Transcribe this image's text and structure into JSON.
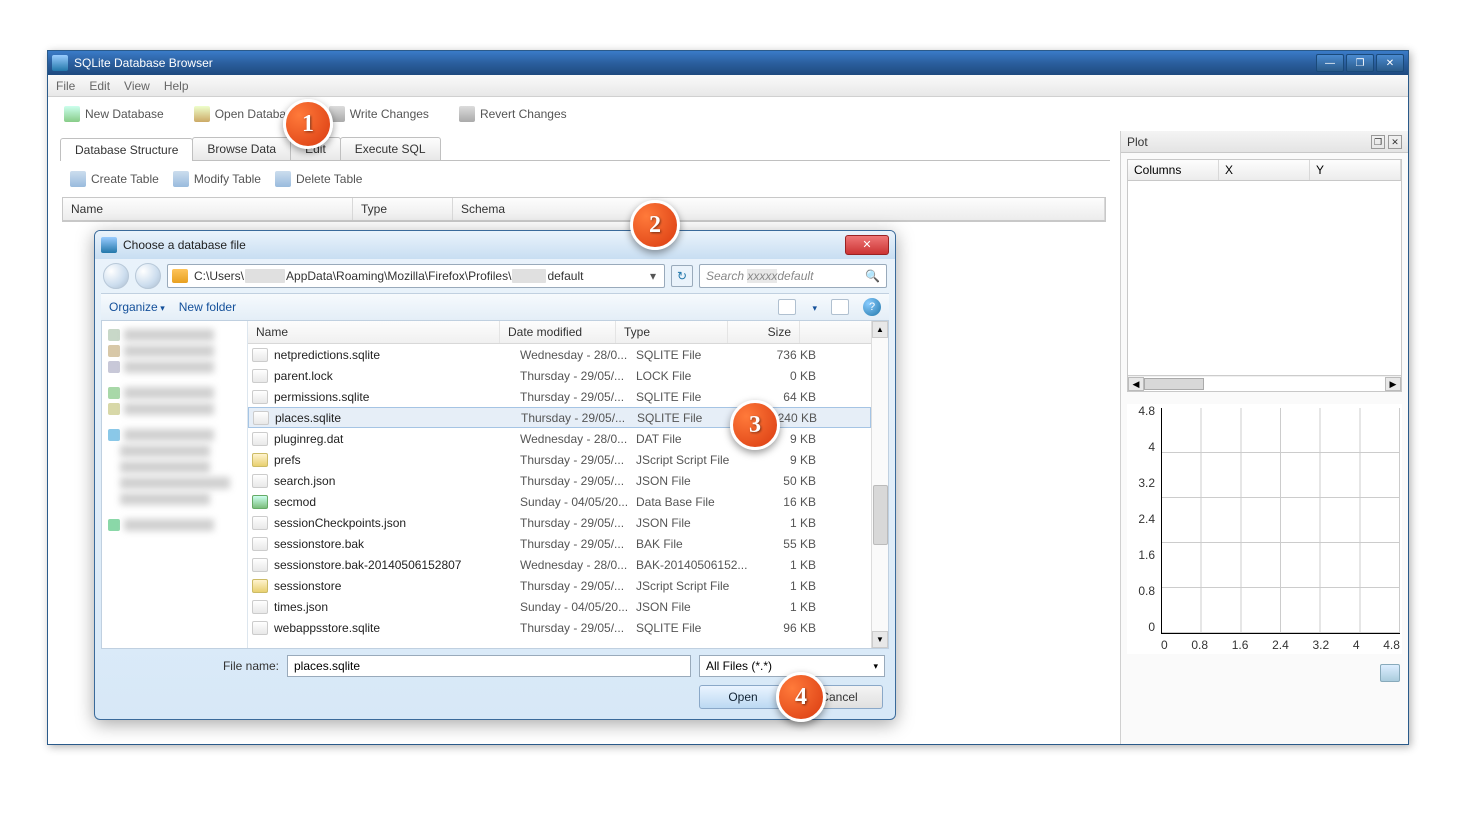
{
  "window": {
    "title": "SQLite Database Browser"
  },
  "menu": {
    "file": "File",
    "edit": "Edit",
    "view": "View",
    "help": "Help"
  },
  "toolbar": {
    "new_db": "New Database",
    "open_db": "Open Database",
    "write_changes": "Write Changes",
    "revert_changes": "Revert Changes"
  },
  "tabs": {
    "structure": "Database Structure",
    "browse": "Browse Data",
    "edit": "Edit",
    "execute": "Execute SQL"
  },
  "subtoolbar": {
    "create": "Create Table",
    "modify": "Modify Table",
    "delete": "Delete Table"
  },
  "structure_cols": {
    "name": "Name",
    "type": "Type",
    "schema": "Schema"
  },
  "plot": {
    "title": "Plot",
    "col_columns": "Columns",
    "col_x": "X",
    "col_y": "Y",
    "scroll_marker": "|||"
  },
  "chart_data": {
    "type": "scatter",
    "x": [],
    "y": [],
    "xlim": [
      0,
      4.8
    ],
    "ylim": [
      0,
      4.8
    ],
    "xticks": [
      "0",
      "0.8",
      "1.6",
      "2.4",
      "3.2",
      "4",
      "4.8"
    ],
    "yticks": [
      "4.8",
      "4",
      "3.2",
      "2.4",
      "1.6",
      "0.8",
      "0"
    ]
  },
  "dialog": {
    "title": "Choose a database file",
    "path_prefix": "C:\\Users\\",
    "path_mid": "AppData\\Roaming\\Mozilla\\Firefox\\Profiles\\",
    "path_suffix": "default",
    "search_placeholder": "Search",
    "search_suffix": "default",
    "organize": "Organize",
    "new_folder": "New folder",
    "cols": {
      "name": "Name",
      "date": "Date modified",
      "type": "Type",
      "size": "Size"
    },
    "files": [
      {
        "name": "netpredictions.sqlite",
        "date": "Wednesday - 28/0...",
        "type": "SQLITE File",
        "size": "736 KB",
        "icon": "file"
      },
      {
        "name": "parent.lock",
        "date": "Thursday - 29/05/...",
        "type": "LOCK File",
        "size": "0 KB",
        "icon": "file"
      },
      {
        "name": "permissions.sqlite",
        "date": "Thursday - 29/05/...",
        "type": "SQLITE File",
        "size": "64 KB",
        "icon": "file"
      },
      {
        "name": "places.sqlite",
        "date": "Thursday - 29/05/...",
        "type": "SQLITE File",
        "size": "10,240 KB",
        "icon": "file",
        "selected": true
      },
      {
        "name": "pluginreg.dat",
        "date": "Wednesday - 28/0...",
        "type": "DAT File",
        "size": "9 KB",
        "icon": "file"
      },
      {
        "name": "prefs",
        "date": "Thursday - 29/05/...",
        "type": "JScript Script File",
        "size": "9 KB",
        "icon": "js"
      },
      {
        "name": "search.json",
        "date": "Thursday - 29/05/...",
        "type": "JSON File",
        "size": "50 KB",
        "icon": "file"
      },
      {
        "name": "secmod",
        "date": "Sunday - 04/05/20...",
        "type": "Data Base File",
        "size": "16 KB",
        "icon": "db"
      },
      {
        "name": "sessionCheckpoints.json",
        "date": "Thursday - 29/05/...",
        "type": "JSON File",
        "size": "1 KB",
        "icon": "file"
      },
      {
        "name": "sessionstore.bak",
        "date": "Thursday - 29/05/...",
        "type": "BAK File",
        "size": "55 KB",
        "icon": "file"
      },
      {
        "name": "sessionstore.bak-20140506152807",
        "date": "Wednesday - 28/0...",
        "type": "BAK-20140506152...",
        "size": "1 KB",
        "icon": "file"
      },
      {
        "name": "sessionstore",
        "date": "Thursday - 29/05/...",
        "type": "JScript Script File",
        "size": "1 KB",
        "icon": "js"
      },
      {
        "name": "times.json",
        "date": "Sunday - 04/05/20...",
        "type": "JSON File",
        "size": "1 KB",
        "icon": "file"
      },
      {
        "name": "webappsstore.sqlite",
        "date": "Thursday - 29/05/...",
        "type": "SQLITE File",
        "size": "96 KB",
        "icon": "file"
      }
    ],
    "filename_label": "File name:",
    "filename_value": "places.sqlite",
    "filter": "All Files (*.*)",
    "open": "Open",
    "cancel": "Cancel"
  },
  "badges": {
    "b1": "1",
    "b2": "2",
    "b3": "3",
    "b4": "4"
  }
}
